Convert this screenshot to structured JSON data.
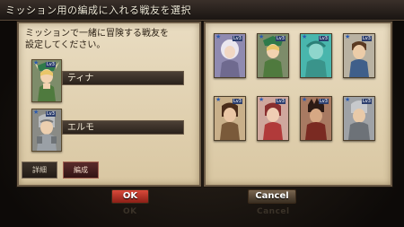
{
  "title": "ミッション用の編成に入れる戦友を選択",
  "instruction_line1": "ミッションで一緒に冒険する戦友を",
  "instruction_line2": "設定してください。",
  "slots": [
    {
      "name": "ティナ",
      "level": "Lv3"
    },
    {
      "name": "エルモ",
      "level": "Lv3"
    }
  ],
  "tabs": {
    "detail": "詳細",
    "formation": "編成"
  },
  "cards": [
    {
      "level": "Lv3"
    },
    {
      "level": "Lv3"
    },
    {
      "level": "Lv3"
    },
    {
      "level": "Lv3"
    },
    {
      "level": "Lv3"
    },
    {
      "level": "Lv3"
    },
    {
      "level": "Lv3"
    },
    {
      "level": "Lv3"
    }
  ],
  "buttons": {
    "ok": "OK",
    "cancel": "Cancel"
  },
  "ghost_buttons": {
    "ok": "OK",
    "cancel": "Cancel"
  },
  "colors": {
    "panel": "#e2d3b3",
    "ok_red": "#c2382a",
    "cancel_brown": "#5b4a38"
  }
}
